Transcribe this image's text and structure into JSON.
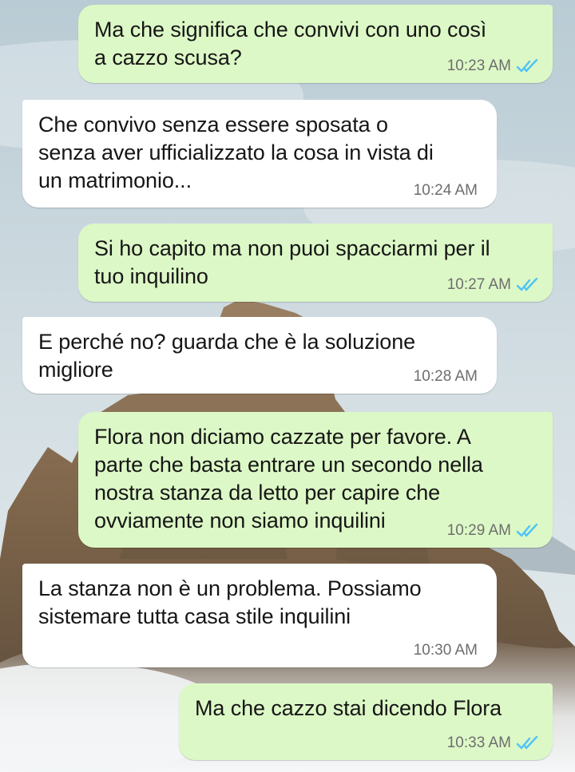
{
  "chat": {
    "messages": [
      {
        "direction": "outgoing",
        "text": "Ma che significa che convivi con uno così\na cazzo scusa?",
        "time": "10:23 AM",
        "status": "read-icon"
      },
      {
        "direction": "incoming",
        "text": "Che convivo senza essere sposata o\nsenza aver ufficializzato la cosa in vista di\nun matrimonio...",
        "time": "10:24 AM"
      },
      {
        "direction": "outgoing",
        "text": "Si ho capito ma non puoi spacciarmi per il\ntuo inquilino",
        "time": "10:27 AM",
        "status": "read-icon"
      },
      {
        "direction": "incoming",
        "text": "E perché no? guarda che è la soluzione\nmigliore",
        "time": "10:28 AM"
      },
      {
        "direction": "outgoing",
        "text": "Flora non diciamo cazzate per favore. A\nparte che basta entrare un secondo nella\nnostra  stanza da letto per capire che\novviamente non siamo inquilini",
        "time": "10:29 AM",
        "status": "read-icon"
      },
      {
        "direction": "incoming",
        "text": "La stanza non è un problema. Possiamo\nsistemare tutta casa stile inquilini",
        "time": "10:30 AM"
      },
      {
        "direction": "outgoing",
        "text": "Ma che cazzo stai dicendo Flora",
        "time": "10:33 AM",
        "status": "read-icon"
      }
    ]
  },
  "colors": {
    "outgoing_bubble": "#dcf8c6",
    "incoming_bubble": "#ffffff",
    "read_ticks": "#4fc3f7",
    "timestamp": "#6e6e6e"
  }
}
